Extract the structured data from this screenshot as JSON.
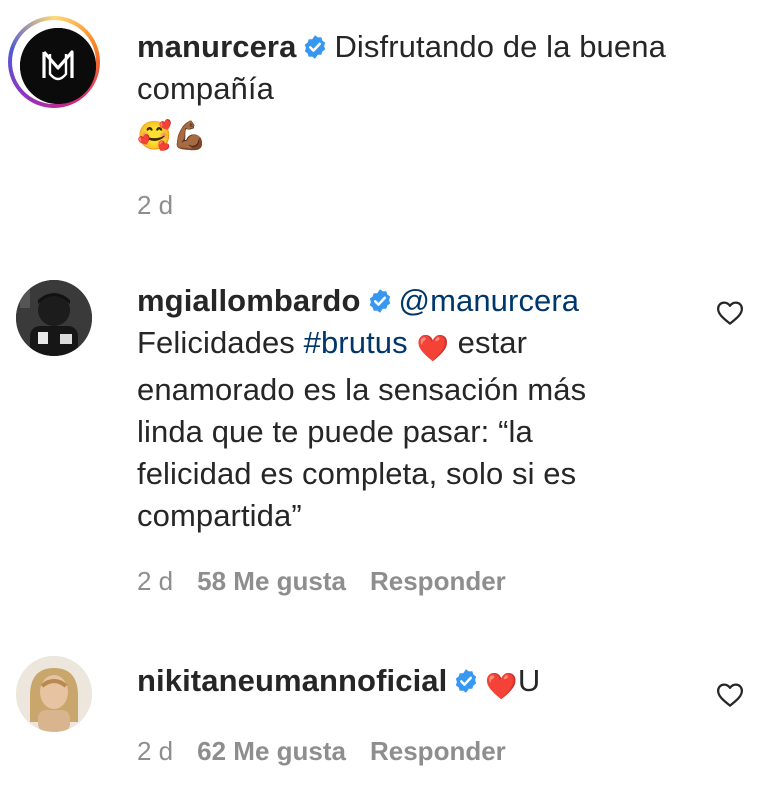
{
  "post": {
    "username": "manurcera",
    "caption_line1": "Disfrutando de la buena",
    "caption_line2": "compañía",
    "caption_emojis": "🥰💪🏾",
    "time": "2 d"
  },
  "comments": [
    {
      "username": "mgiallombardo",
      "mention": "@manurcera",
      "text_before_hashtag": "Felicidades ",
      "hashtag": "#brutus",
      "heart_emoji": "❤️",
      "text_after_heart": " estar",
      "line2": "enamorado es la sensación más",
      "line3": "linda que te puede pasar: “la",
      "line4": "felicidad es completa, solo si es",
      "line5": "compartida”",
      "time": "2 d",
      "likes": "58 Me gusta",
      "reply": "Responder"
    },
    {
      "username": "nikitaneumannoficial",
      "heart_emoji": "❤️",
      "text": "U",
      "time": "2 d",
      "likes": "62 Me gusta",
      "reply": "Responder"
    }
  ],
  "icons": {
    "verified": "verified-badge-icon",
    "like": "heart-outline-icon"
  },
  "colors": {
    "verified_blue": "#3897f0",
    "link_blue": "#00376b",
    "meta_gray": "#8e8e8e",
    "text": "#262626"
  }
}
